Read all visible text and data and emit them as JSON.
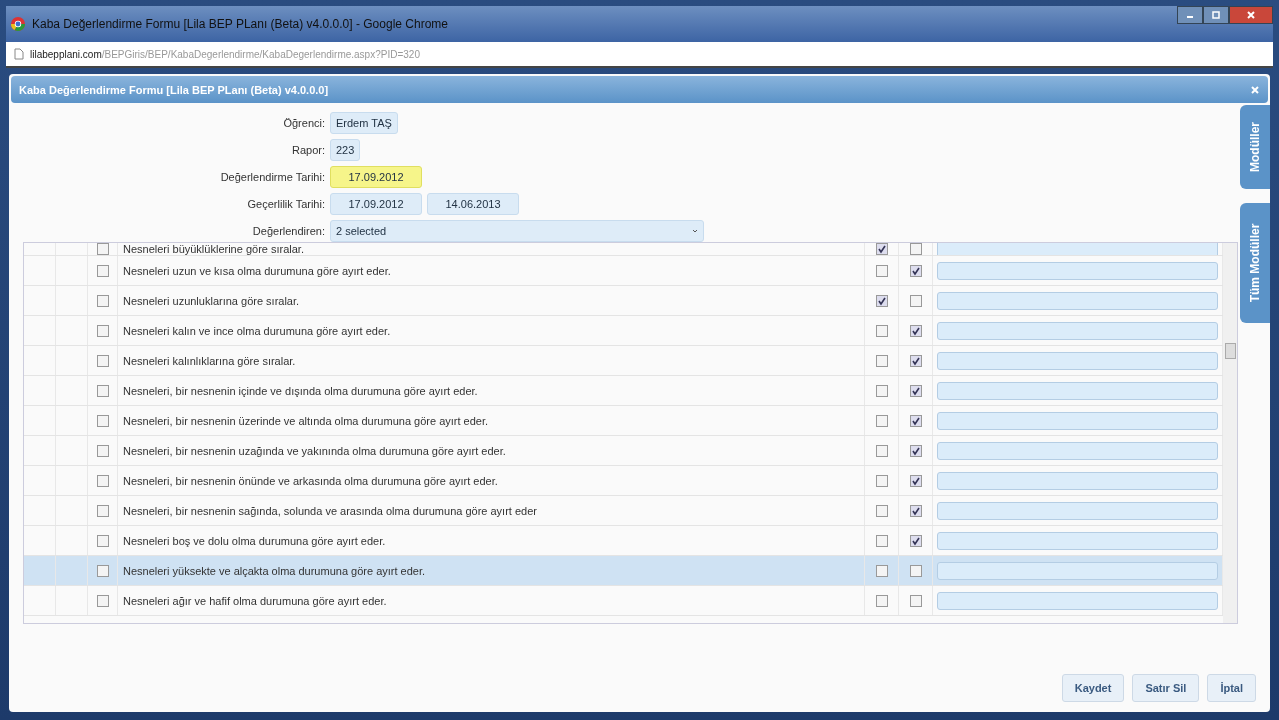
{
  "window": {
    "title": "Kaba Değerlendirme Formu [Lila BEP PLanı (Beta) v4.0.0.0] - Google Chrome"
  },
  "address_bar": {
    "host": "lilabepplani.com",
    "path": "/BEPGiris/BEP/KabaDegerlendirme/KabaDegerlendirme.aspx?PID=320"
  },
  "dialog": {
    "title": "Kaba Değerlendirme Formu [Lila BEP PLanı (Beta) v4.0.0.0]"
  },
  "side_tabs": [
    "Modüller",
    "Tüm Modüller"
  ],
  "form": [
    {
      "label": "Öğrenci:",
      "values": [
        "Erdem TAŞ"
      ],
      "kind": "text"
    },
    {
      "label": "Rapor:",
      "values": [
        "223"
      ],
      "kind": "text"
    },
    {
      "label": "Değerlendirme Tarihi:",
      "values": [
        "17.09.2012"
      ],
      "kind": "highlight"
    },
    {
      "label": "Geçerlilik Tarihi:",
      "values": [
        "17.09.2012",
        "14.06.2013"
      ],
      "kind": "date"
    },
    {
      "label": "Değerlendiren:",
      "values": [
        "2 selected"
      ],
      "kind": "select"
    }
  ],
  "rows": [
    {
      "text": "Nesneleri büyüklüklerine göre sıralar.",
      "checked": false,
      "col_1": true,
      "col_2": false,
      "selected": false
    },
    {
      "text": "Nesneleri uzun ve kısa olma durumuna göre ayırt eder.",
      "checked": false,
      "col_1": false,
      "col_2": true,
      "selected": false
    },
    {
      "text": "Nesneleri uzunluklarına göre sıralar.",
      "checked": false,
      "col_1": true,
      "col_2": false,
      "selected": false
    },
    {
      "text": "Nesneleri kalın ve ince olma durumuna göre ayırt eder.",
      "checked": false,
      "col_1": false,
      "col_2": true,
      "selected": false
    },
    {
      "text": "Nesneleri kalınlıklarına göre sıralar.",
      "checked": false,
      "col_1": false,
      "col_2": true,
      "selected": false
    },
    {
      "text": "Nesneleri, bir nesnenin içinde ve dışında olma durumuna göre ayırt eder.",
      "checked": false,
      "col_1": false,
      "col_2": true,
      "selected": false
    },
    {
      "text": "Nesneleri, bir nesnenin üzerinde ve altında olma durumuna göre ayırt eder.",
      "checked": false,
      "col_1": false,
      "col_2": true,
      "selected": false
    },
    {
      "text": "Nesneleri, bir nesnenin uzağında ve yakınında olma durumuna göre ayırt eder.",
      "checked": false,
      "col_1": false,
      "col_2": true,
      "selected": false
    },
    {
      "text": "Nesneleri, bir nesnenin önünde ve arkasında olma durumuna göre ayırt eder.",
      "checked": false,
      "col_1": false,
      "col_2": true,
      "selected": false
    },
    {
      "text": "Nesneleri, bir nesnenin sağında, solunda ve arasında olma durumuna göre ayırt eder",
      "checked": false,
      "col_1": false,
      "col_2": true,
      "selected": false
    },
    {
      "text": "Nesneleri boş ve dolu olma durumuna göre ayırt eder.",
      "checked": false,
      "col_1": false,
      "col_2": true,
      "selected": false
    },
    {
      "text": "Nesneleri yüksekte ve alçakta olma durumuna göre ayırt eder.",
      "checked": false,
      "col_1": false,
      "col_2": false,
      "selected": true
    },
    {
      "text": "Nesneleri ağır ve hafif olma durumuna göre ayırt eder.",
      "checked": false,
      "col_1": false,
      "col_2": false,
      "selected": false
    }
  ],
  "buttons": [
    "Kaydet",
    "Satır Sil",
    "İptal"
  ]
}
